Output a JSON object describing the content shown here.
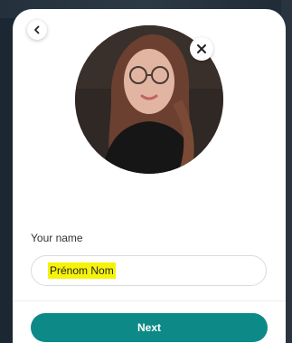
{
  "profile": {
    "back_icon": "chevron-left-icon",
    "remove_icon": "close-icon",
    "avatar_description": "profile-photo"
  },
  "form": {
    "name_label": "Your name",
    "name_value": "Prénom Nom",
    "highlight_color": "#f6f20a"
  },
  "actions": {
    "next_label": "Next",
    "accent_color": "#0d8a87"
  }
}
